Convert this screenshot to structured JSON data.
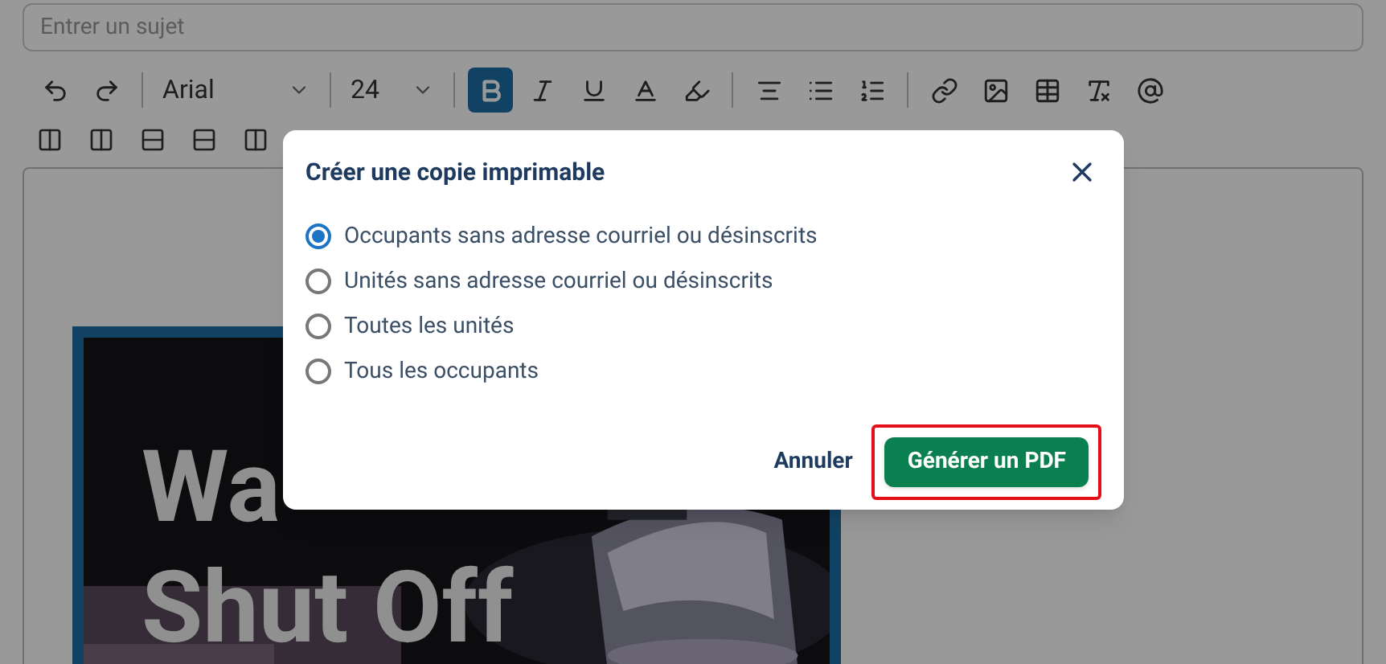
{
  "subject": {
    "placeholder": "Entrer un sujet"
  },
  "toolbar": {
    "font": "Arial",
    "size": "24",
    "buttons": [
      {
        "selected": false
      },
      {
        "selected": false
      },
      {
        "selected": true
      },
      {
        "selected": false
      },
      {
        "selected": false
      },
      {
        "selected": false
      },
      {
        "selected": false
      },
      {
        "selected": false
      },
      {
        "selected": false
      },
      {
        "selected": false
      },
      {
        "selected": false
      },
      {
        "selected": false
      },
      {
        "selected": false
      },
      {
        "selected": false
      },
      {
        "selected": false
      }
    ]
  },
  "editor": {
    "heading_lines": [
      "Wa",
      "Shut Off"
    ]
  },
  "dialog": {
    "title": "Créer une copie imprimable",
    "options": [
      {
        "label": "Occupants sans adresse courriel ou désinscrits",
        "selected": true
      },
      {
        "label": "Unités sans adresse courriel ou désinscrits",
        "selected": false
      },
      {
        "label": "Toutes les unités",
        "selected": false
      },
      {
        "label": "Tous les occupants",
        "selected": false
      }
    ],
    "cancel": "Annuler",
    "confirm": "Générer un PDF",
    "confirm_highlighted": true
  }
}
